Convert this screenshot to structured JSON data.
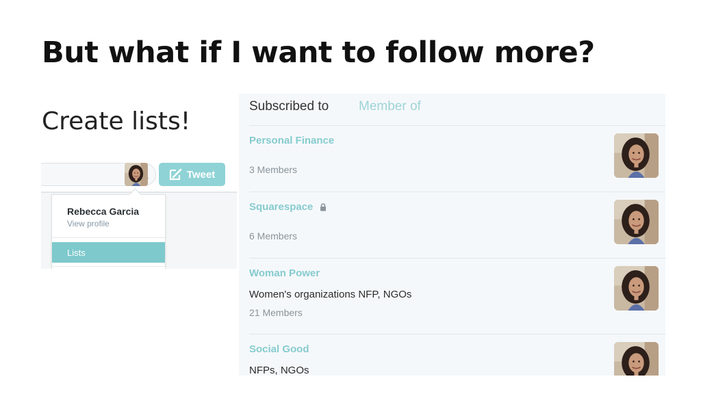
{
  "slide": {
    "title": "But what if I want to follow more?",
    "subtitle": "Create lists!"
  },
  "twitter_header": {
    "search_placeholder": "",
    "search_icon": "search-icon",
    "tweet_label": "Tweet",
    "tweet_icon": "compose-icon",
    "accent_color": "#8fd3d6",
    "dropdown": {
      "name": "Rebecca Garcia",
      "view_profile": "View profile",
      "menu_items": [
        {
          "label": "Lists",
          "active": true
        }
      ]
    }
  },
  "lists_panel": {
    "tabs": [
      {
        "label": "Subscribed to",
        "active": true
      },
      {
        "label": "Member of",
        "active": false
      }
    ],
    "lists": [
      {
        "name": "Personal Finance",
        "locked": false,
        "description": "",
        "members": "3 Members"
      },
      {
        "name": "Squarespace",
        "locked": true,
        "description": "",
        "members": "6 Members"
      },
      {
        "name": "Woman Power",
        "locked": false,
        "description": "Women's organizations NFP, NGOs",
        "members": "21 Members"
      },
      {
        "name": "Social Good",
        "locked": false,
        "description": "NFPs, NGOs",
        "members": ""
      }
    ]
  }
}
